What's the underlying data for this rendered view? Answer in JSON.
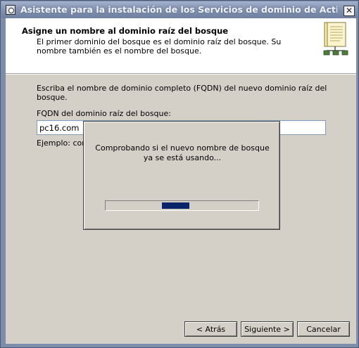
{
  "window": {
    "title": "Asistente para la instalación de los Servicios de dominio de Active Directory",
    "close_label": "✕"
  },
  "header": {
    "title": "Asigne un nombre al dominio raíz del bosque",
    "description": "El primer dominio del bosque es el dominio raíz del bosque. Su nombre también es el nombre del bosque."
  },
  "main": {
    "instruction": "Escriba el nombre de dominio completo (FQDN) del nuevo dominio raíz del bosque.",
    "fqdn_label": "FQDN del dominio raíz del bosque:",
    "fqdn_value": "pc16.com",
    "example_text": "Ejemplo: corp."
  },
  "progress_dialog": {
    "message": "Comprobando si el nuevo nombre de bosque ya se está usando...",
    "progress": 0.45
  },
  "footer": {
    "back_label": "< Atrás",
    "next_label": "Siguiente >",
    "cancel_label": "Cancelar"
  },
  "icons": [
    "app-icon",
    "close-icon",
    "book-network-icon"
  ]
}
